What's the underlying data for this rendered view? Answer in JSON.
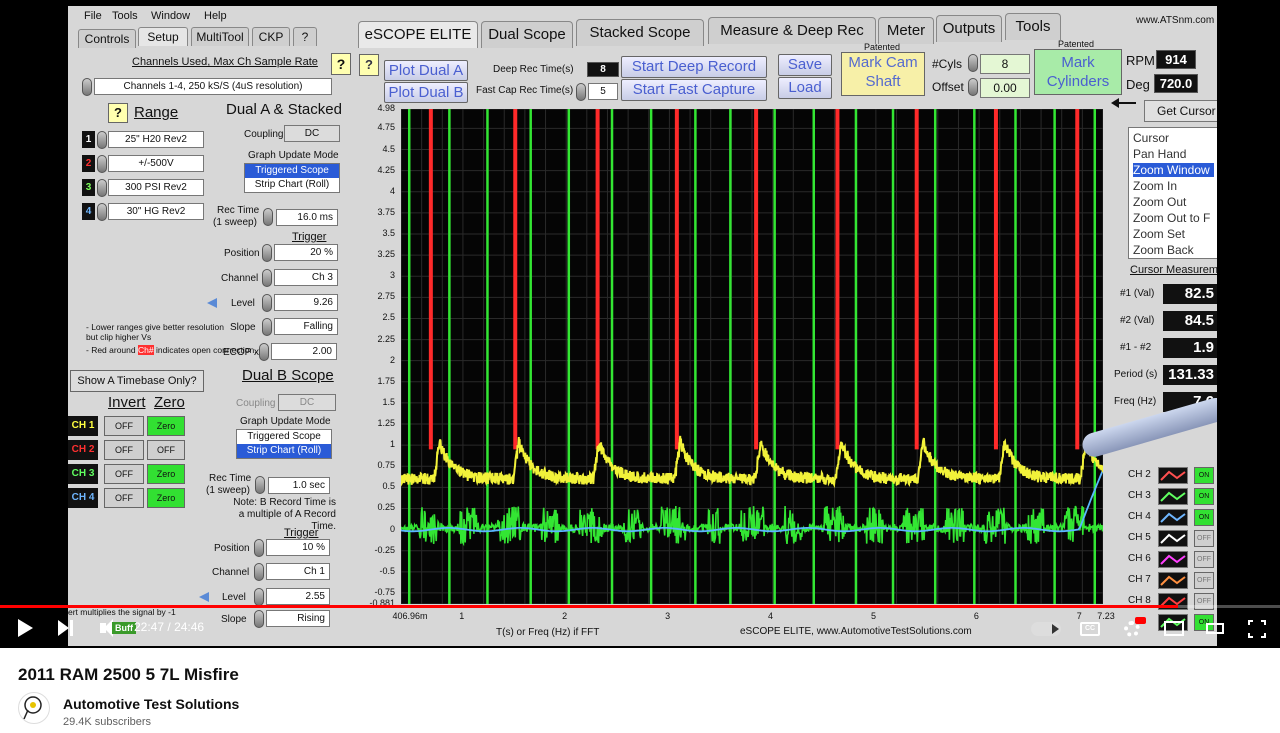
{
  "menu": [
    "File",
    "Tools",
    "Window",
    "Help"
  ],
  "left_tabs": [
    "Controls",
    "Setup",
    "MultiTool",
    "CKP",
    "?"
  ],
  "top_tabs": [
    "eSCOPE ELITE",
    "Dual Scope",
    "Stacked Scope",
    "Measure & Deep Rec",
    "Meter",
    "Outputs",
    "Tools"
  ],
  "brand_url": "www.ATSnm.com",
  "channels_used_label": "Channels Used, Max Ch Sample Rate",
  "channels_used_value": "Channels 1-4, 250 kS/S (4uS resolution)",
  "question_mark": "?",
  "range": {
    "title": "Range",
    "items": [
      {
        "num": "1",
        "value": "25\" H20 Rev2",
        "color": "#ffffff"
      },
      {
        "num": "2",
        "value": "+/-500V",
        "color": "#ff3030"
      },
      {
        "num": "3",
        "value": "300 PSI Rev2",
        "color": "#7cff5a"
      },
      {
        "num": "4",
        "value": "30\" HG Rev2",
        "color": "#6fb6ff"
      }
    ],
    "note": "- Lower ranges give better resolution but clip higher Vs",
    "note2": "- Red around",
    "note_tag": "Ch#",
    "note3": "indicates open connection.",
    "timebase_button": "Show A Timebase Only?"
  },
  "dual_a": {
    "title": "Dual A & Stacked",
    "coupling_label": "Coupling",
    "coupling_value": "DC",
    "graph_update_label": "Graph Update Mode",
    "mode_selected": "Triggered Scope",
    "mode_other": "Strip Chart (Roll)",
    "rec_time_label": "Rec Time",
    "rec_time_sub": "(1 sweep)",
    "rec_time_value": "16.0 ms",
    "trigger_label": "Trigger",
    "position_label": "Position",
    "position_value": "20 %",
    "channel_label": "Channel",
    "channel_value": "Ch 3",
    "level_label": "Level",
    "level_value": "9.26",
    "slope_label": "Slope",
    "slope_value": "Falling",
    "ecop_label": "ECOP x",
    "ecop_value": "2.00"
  },
  "dual_b": {
    "title": "Dual B Scope",
    "coupling_label": "Coupling",
    "coupling_value": "DC",
    "graph_update_label": "Graph Update Mode",
    "mode_other": "Triggered Scope",
    "mode_selected": "Strip Chart (Roll)",
    "rec_time_label": "Rec Time",
    "rec_time_sub": "(1 sweep)",
    "rec_time_value": "1.0 sec",
    "note": "Note: B Record Time is a multiple of A Record Time.",
    "trigger_label": "Trigger",
    "position_label": "Position",
    "position_value": "10 %",
    "channel_label": "Channel",
    "channel_value": "Ch 1",
    "level_label": "Level",
    "level_value": "2.55",
    "slope_label": "Slope",
    "slope_value": "Rising"
  },
  "invert_zero": {
    "invert_title": "Invert",
    "zero_title": "Zero",
    "rows": [
      {
        "ch": "CH 1",
        "color": "#ffff40",
        "invert": "OFF",
        "zero": "Zero",
        "zero_on": true
      },
      {
        "ch": "CH 2",
        "color": "#ff3030",
        "invert": "OFF",
        "zero": "OFF",
        "zero_on": false
      },
      {
        "ch": "CH 3",
        "color": "#60ff60",
        "invert": "OFF",
        "zero": "Zero",
        "zero_on": true
      },
      {
        "ch": "CH 4",
        "color": "#6fb6ff",
        "invert": "OFF",
        "zero": "Zero",
        "zero_on": true
      }
    ],
    "bottom_note": "ert multiplies the signal by -1"
  },
  "record": {
    "plot_dual_a": "Plot Dual A",
    "plot_dual_b": "Plot Dual B",
    "deep_rec_label": "Deep Rec Time(s)",
    "deep_rec_value": "8",
    "fast_cap_label": "Fast Cap Rec Time(s)",
    "fast_cap_value": "5",
    "start_deep": "Start Deep Record",
    "start_fast": "Start Fast Capture",
    "save": "Save",
    "load": "Load",
    "patented_1": "Patented",
    "mark_cam": "Mark Cam Shaft",
    "cyls_label": "#Cyls",
    "cyls_value": "8",
    "offset_label": "Offset",
    "offset_value": "0.00",
    "patented_2": "Patented",
    "mark_cylinders": "Mark Cylinders",
    "rpm_label": "RPM",
    "rpm_value": "914",
    "deg_label": "Deg",
    "deg_value": "720.0",
    "get_cursor": "Get Cursor"
  },
  "tools_list": [
    "Cursor",
    "Pan Hand",
    "Zoom Window",
    "Zoom In",
    "Zoom Out",
    "Zoom Out to F",
    "Zoom Set",
    "Zoom Back"
  ],
  "tools_selected": "Zoom Window",
  "cursor_measure": {
    "title": "Cursor Measurem",
    "rows": [
      {
        "label": "#1 (Val)",
        "value": "82.5"
      },
      {
        "label": "#2 (Val)",
        "value": "84.5"
      },
      {
        "label": "#1 - #2",
        "value": "1.9"
      },
      {
        "label": "Period (s)",
        "value": "131.33"
      },
      {
        "label": "Freq (Hz)",
        "value": "7.6"
      }
    ]
  },
  "right_channels": [
    {
      "label": "CH 2",
      "color": "#ff5050",
      "state": "ON"
    },
    {
      "label": "CH 3",
      "color": "#60ff60",
      "state": "ON"
    },
    {
      "label": "CH 4",
      "color": "#6fb6ff",
      "state": "ON"
    },
    {
      "label": "CH 5",
      "color": "#ffffff",
      "state": "OFF"
    },
    {
      "label": "CH 6",
      "color": "#ff40ff",
      "state": "OFF"
    },
    {
      "label": "CH 7",
      "color": "#ff9040",
      "state": "OFF"
    },
    {
      "label": "CH 8",
      "color": "#ff4040",
      "state": "OFF"
    },
    {
      "label": "",
      "color": "#60ff60",
      "state": "ON"
    }
  ],
  "chart_data": {
    "type": "line",
    "xlabel": "T(s) or Freq (Hz) if FFT",
    "footer": "eSCOPE ELITE, www.AutomotiveTestSolutions.com",
    "x_start_label": "406.96m",
    "x_end_label": "7.23",
    "x_ticks": [
      "1",
      "2",
      "3",
      "4",
      "5",
      "6",
      "7"
    ],
    "xlim": [
      0.41,
      7.23
    ],
    "y_ticks": [
      "4.98",
      "4.75",
      "4.5",
      "4.25",
      "4",
      "3.75",
      "3.5",
      "3.25",
      "3",
      "2.75",
      "2.5",
      "2.25",
      "2",
      "1.75",
      "1.5",
      "1.25",
      "1",
      "0.75",
      "0.5",
      "0.25",
      "0",
      "-0.25",
      "-0.5",
      "-0.75",
      "-0.881"
    ],
    "ylim": [
      -0.881,
      4.98
    ],
    "grid": true,
    "red_marker_x": [
      0.7,
      1.52,
      2.32,
      3.09,
      3.86,
      4.65,
      5.42,
      6.19,
      6.98
    ],
    "green_marker_x": [
      0.49,
      0.88,
      1.25,
      1.67,
      2.04,
      2.46,
      2.84,
      3.27,
      3.61,
      4.04,
      4.42,
      4.83,
      5.19,
      5.6,
      5.98,
      6.38,
      6.76,
      7.15
    ],
    "series": [
      {
        "color": "#f2f23a",
        "baseline": 0.6,
        "peak_x": [
          0.78,
          1.55,
          2.33,
          3.12,
          3.9,
          4.68,
          5.48,
          6.27,
          7.06
        ],
        "peak_y": 1.05
      },
      {
        "color": "#33e633",
        "band": [
          -0.2,
          0.25
        ]
      },
      {
        "color": "#5ab6ff",
        "baseline": 0.0
      }
    ]
  },
  "player": {
    "current_time": "22:47",
    "duration": "24:46",
    "time_separator": "/",
    "progress": 0.92,
    "chapter_chip": "Buff"
  },
  "video_title": "2011 RAM 2500 5 7L Misfire",
  "channel_name": "Automotive Test Solutions",
  "subscribers": "29.4K subscribers"
}
